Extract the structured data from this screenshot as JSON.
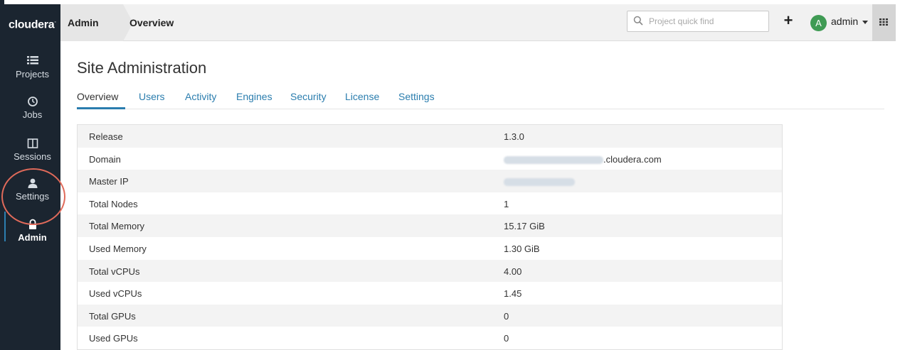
{
  "brand": {
    "logo_text": "cloudera"
  },
  "header": {
    "breadcrumb_section": "Admin",
    "breadcrumb_page": "Overview",
    "search_placeholder": "Project quick find",
    "user_initial": "A",
    "user_name": "admin"
  },
  "sidebar": {
    "items": [
      {
        "label": "Projects",
        "icon": "list-icon"
      },
      {
        "label": "Jobs",
        "icon": "clock-icon"
      },
      {
        "label": "Sessions",
        "icon": "columns-icon"
      },
      {
        "label": "Settings",
        "icon": "user-icon"
      },
      {
        "label": "Admin",
        "icon": "lock-icon",
        "active": true
      }
    ]
  },
  "page": {
    "title": "Site Administration",
    "tabs": [
      "Overview",
      "Users",
      "Activity",
      "Engines",
      "Security",
      "License",
      "Settings"
    ],
    "active_tab": "Overview"
  },
  "overview": {
    "rows": [
      {
        "key": "Release",
        "value": "1.3.0"
      },
      {
        "key": "Domain",
        "value": ".cloudera.com",
        "redacted_prefix": true
      },
      {
        "key": "Master IP",
        "value": "",
        "redacted": true
      },
      {
        "key": "Total Nodes",
        "value": "1"
      },
      {
        "key": "Total Memory",
        "value": "15.17 GiB"
      },
      {
        "key": "Used Memory",
        "value": "1.30 GiB"
      },
      {
        "key": "Total vCPUs",
        "value": "4.00"
      },
      {
        "key": "Used vCPUs",
        "value": "1.45"
      },
      {
        "key": "Total GPUs",
        "value": "0"
      },
      {
        "key": "Used GPUs",
        "value": "0"
      }
    ]
  },
  "colors": {
    "sidebar_bg": "#1b2530",
    "link": "#2a7dae",
    "annotation": "#e06a5a",
    "avatar": "#3f9b54"
  }
}
